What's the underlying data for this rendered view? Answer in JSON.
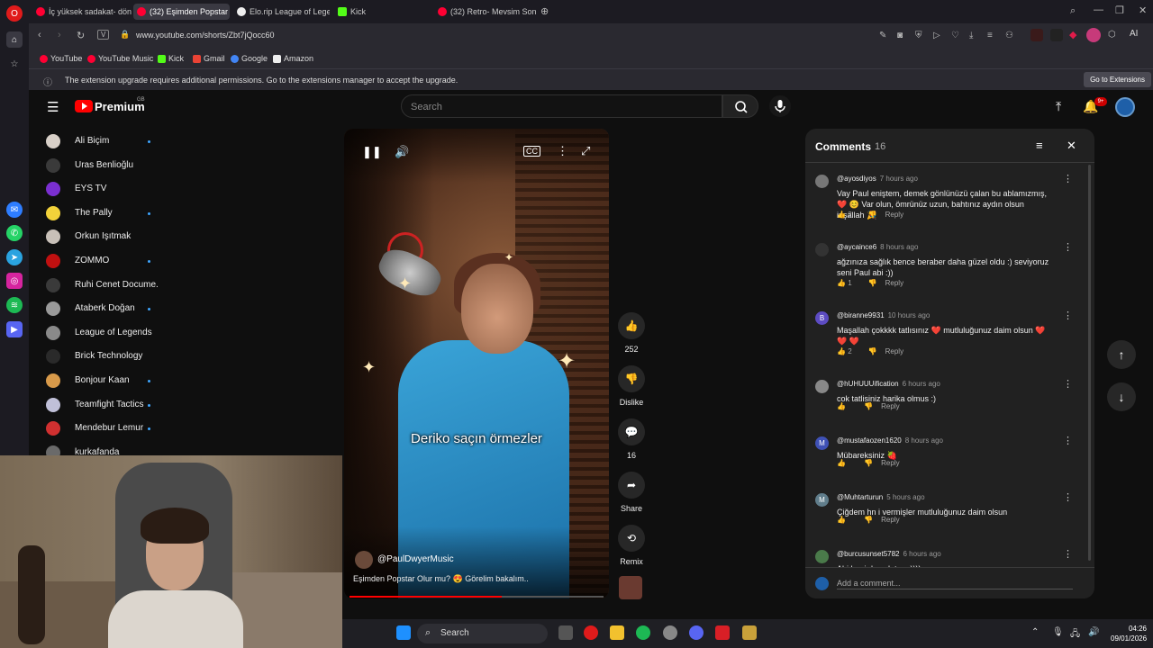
{
  "browser": {
    "tabs": [
      {
        "title": "İç yüksek sadakat- dönem",
        "active": false,
        "color": "#ff0033"
      },
      {
        "title": "(32) Eşimden Popstar",
        "active": true,
        "color": "#ff0033"
      },
      {
        "title": "Elo.rip League of Legends",
        "active": false,
        "color": "#eeeeee"
      },
      {
        "title": "Kick",
        "active": false,
        "color": "#53fc18"
      },
      {
        "title": "(32) Retro- Mevsim Sonba",
        "active": false,
        "color": "#ff0033"
      }
    ],
    "url": "www.youtube.com/shorts/Zbt7jQocc60",
    "bookmarks": [
      {
        "label": "YouTube",
        "color": "#ff0033"
      },
      {
        "label": "YouTube Music",
        "color": "#ff0033"
      },
      {
        "label": "Kick",
        "color": "#53fc18"
      },
      {
        "label": "Gmail",
        "color": "#ea4335"
      },
      {
        "label": "Google",
        "color": "#4285f4"
      },
      {
        "label": "Amazon",
        "color": "#eeeeee"
      }
    ],
    "notice": "The extension upgrade requires additional permissions. Go to the extensions manager to accept the upgrade.",
    "notice_button": "Go to Extensions",
    "ai_label": "AI"
  },
  "youtube": {
    "logo": "Premium",
    "logo_country": "GB",
    "search_placeholder": "Search",
    "notifications": "9+",
    "subscriptions": [
      {
        "name": "Ali Biçim",
        "new": true,
        "color": "#d8d0c8"
      },
      {
        "name": "Uras Benlioğlu",
        "new": false,
        "color": "#3a3a3a"
      },
      {
        "name": "EYS TV",
        "new": false,
        "color": "#7a2fd0"
      },
      {
        "name": "The Pally",
        "new": true,
        "color": "#f2d23a"
      },
      {
        "name": "Orkun Işıtmak",
        "new": false,
        "color": "#c8c0b8"
      },
      {
        "name": "ZOMMO",
        "new": true,
        "color": "#c01010"
      },
      {
        "name": "Ruhi Cenet Docume...",
        "new": false,
        "color": "#3a3a3a"
      },
      {
        "name": "Ataberk Doğan",
        "new": true,
        "color": "#9a9a9a"
      },
      {
        "name": "League of Legends",
        "new": false,
        "color": "#8a8a8a"
      },
      {
        "name": "Brick Technology",
        "new": false,
        "color": "#2a2a2a"
      },
      {
        "name": "Bonjour Kaan",
        "new": true,
        "color": "#d89a4a"
      },
      {
        "name": "Teamfight Tactics",
        "new": true,
        "color": "#c0c0d8"
      },
      {
        "name": "Mendebur Lemur",
        "new": true,
        "color": "#d03030"
      },
      {
        "name": "kurkafanda",
        "new": false,
        "color": "#6a6a6a"
      }
    ]
  },
  "short": {
    "subtitle": "Deriko saçın örmezler",
    "channel": "@PaulDwyerMusic",
    "caption": "Eşimden Popstar Olur mu? 😍 Görelim bakalım..",
    "progress": 0.6,
    "actions": {
      "likes": "252",
      "dislike": "Dislike",
      "comments": "16",
      "share": "Share",
      "remix": "Remix"
    }
  },
  "comments": {
    "title": "Comments",
    "count": "16",
    "add_placeholder": "Add a comment...",
    "items": [
      {
        "author": "@ayosdiyos",
        "time": "7 hours ago",
        "text": "Vay Paul eniştem, demek gönlünüzü çalan bu ablamızmış, ❤️ 😊 Var olun, ömrünüz uzun, bahtınız aydın olsun inşallah 🎉",
        "likes": "2",
        "reply": "Reply",
        "initial": "",
        "color": "#777777"
      },
      {
        "author": "@aycaince6",
        "time": "8 hours ago",
        "text": "ağzınıza sağlık bence beraber daha güzel oldu :) seviyoruz seni Paul abi :))",
        "likes": "1",
        "reply": "Reply",
        "initial": "",
        "color": "#333333"
      },
      {
        "author": "@biranne9931",
        "time": "10 hours ago",
        "text": "Maşallah çokkkk tatlısınız ❤️ mutluluğunuz daim olsun ❤️ ❤️ ❤️",
        "likes": "2",
        "reply": "Reply",
        "initial": "B",
        "color": "#5c4bc2"
      },
      {
        "author": "@hUHUUUification",
        "time": "6 hours ago",
        "text": "cok tatlisiniz harika olmus :)",
        "likes": "",
        "reply": "Reply",
        "initial": "",
        "color": "#888888"
      },
      {
        "author": "@mustafaozen1620",
        "time": "8 hours ago",
        "text": "Mübareksiniz 🍓",
        "likes": "",
        "reply": "Reply",
        "initial": "M",
        "color": "#3f51b5"
      },
      {
        "author": "@Muhtarturun",
        "time": "5 hours ago",
        "text": "Çiğdem hn i vermişler mutluluğunuz daim olsun",
        "likes": "",
        "reply": "Reply",
        "initial": "M",
        "color": "#607d8b"
      },
      {
        "author": "@burcusunset5782",
        "time": "6 hours ago",
        "text": "Abi beni de evlat ıa :))))",
        "likes": "",
        "reply": "Reply",
        "initial": "",
        "color": "#4a7a4a"
      }
    ]
  },
  "taskbar": {
    "search": "Search",
    "time": "04:26",
    "date": "09/01/2026"
  }
}
